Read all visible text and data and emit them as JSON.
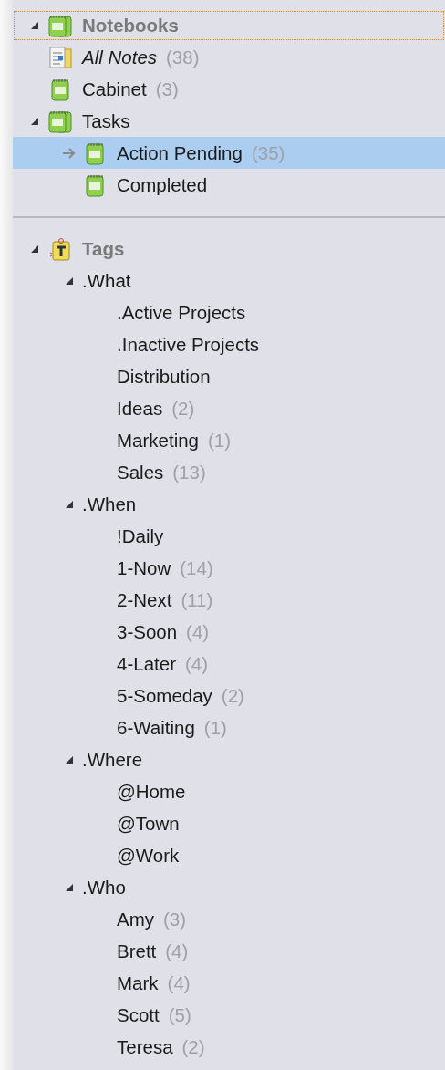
{
  "sections": [
    {
      "label": "Notebooks",
      "kind": "stack",
      "expanded": true,
      "focused": true,
      "selected": false,
      "children": [
        {
          "label": "All Notes",
          "kind": "all-notes",
          "count": "(38)",
          "selected": false
        },
        {
          "label": "Cabinet",
          "kind": "notebook",
          "count": "(3)",
          "selected": false
        },
        {
          "label": "Tasks",
          "kind": "stack",
          "expanded": true,
          "selected": false,
          "children": [
            {
              "label": "Action Pending",
              "kind": "notebook",
              "count": "(35)",
              "selected": true
            },
            {
              "label": "Completed",
              "kind": "notebook",
              "selected": false
            }
          ]
        }
      ]
    },
    {
      "label": "Tags",
      "kind": "tag-root",
      "expanded": true,
      "focused": false,
      "selected": false,
      "children": [
        {
          "label": ".What",
          "expanded": true,
          "selected": false,
          "children": [
            {
              "label": ".Active Projects",
              "selected": false
            },
            {
              "label": ".Inactive Projects",
              "selected": false
            },
            {
              "label": "Distribution",
              "selected": false
            },
            {
              "label": "Ideas",
              "count": "(2)",
              "selected": false
            },
            {
              "label": "Marketing",
              "count": "(1)",
              "selected": false
            },
            {
              "label": "Sales",
              "count": "(13)",
              "selected": false
            }
          ]
        },
        {
          "label": ".When",
          "expanded": true,
          "selected": false,
          "children": [
            {
              "label": "!Daily",
              "selected": false
            },
            {
              "label": "1-Now",
              "count": "(14)",
              "selected": false
            },
            {
              "label": "2-Next",
              "count": "(11)",
              "selected": false
            },
            {
              "label": "3-Soon",
              "count": "(4)",
              "selected": false
            },
            {
              "label": "4-Later",
              "count": "(4)",
              "selected": false
            },
            {
              "label": "5-Someday",
              "count": "(2)",
              "selected": false
            },
            {
              "label": "6-Waiting",
              "count": "(1)",
              "selected": false
            }
          ]
        },
        {
          "label": ".Where",
          "expanded": true,
          "selected": false,
          "children": [
            {
              "label": "@Home",
              "selected": false
            },
            {
              "label": "@Town",
              "selected": false
            },
            {
              "label": "@Work",
              "selected": false
            }
          ]
        },
        {
          "label": ".Who",
          "expanded": true,
          "selected": false,
          "children": [
            {
              "label": "Amy",
              "count": "(3)",
              "selected": false
            },
            {
              "label": "Brett",
              "count": "(4)",
              "selected": false
            },
            {
              "label": "Mark",
              "count": "(4)",
              "selected": false
            },
            {
              "label": "Scott",
              "count": "(5)",
              "selected": false
            },
            {
              "label": "Teresa",
              "count": "(2)",
              "selected": false
            }
          ]
        }
      ]
    }
  ]
}
